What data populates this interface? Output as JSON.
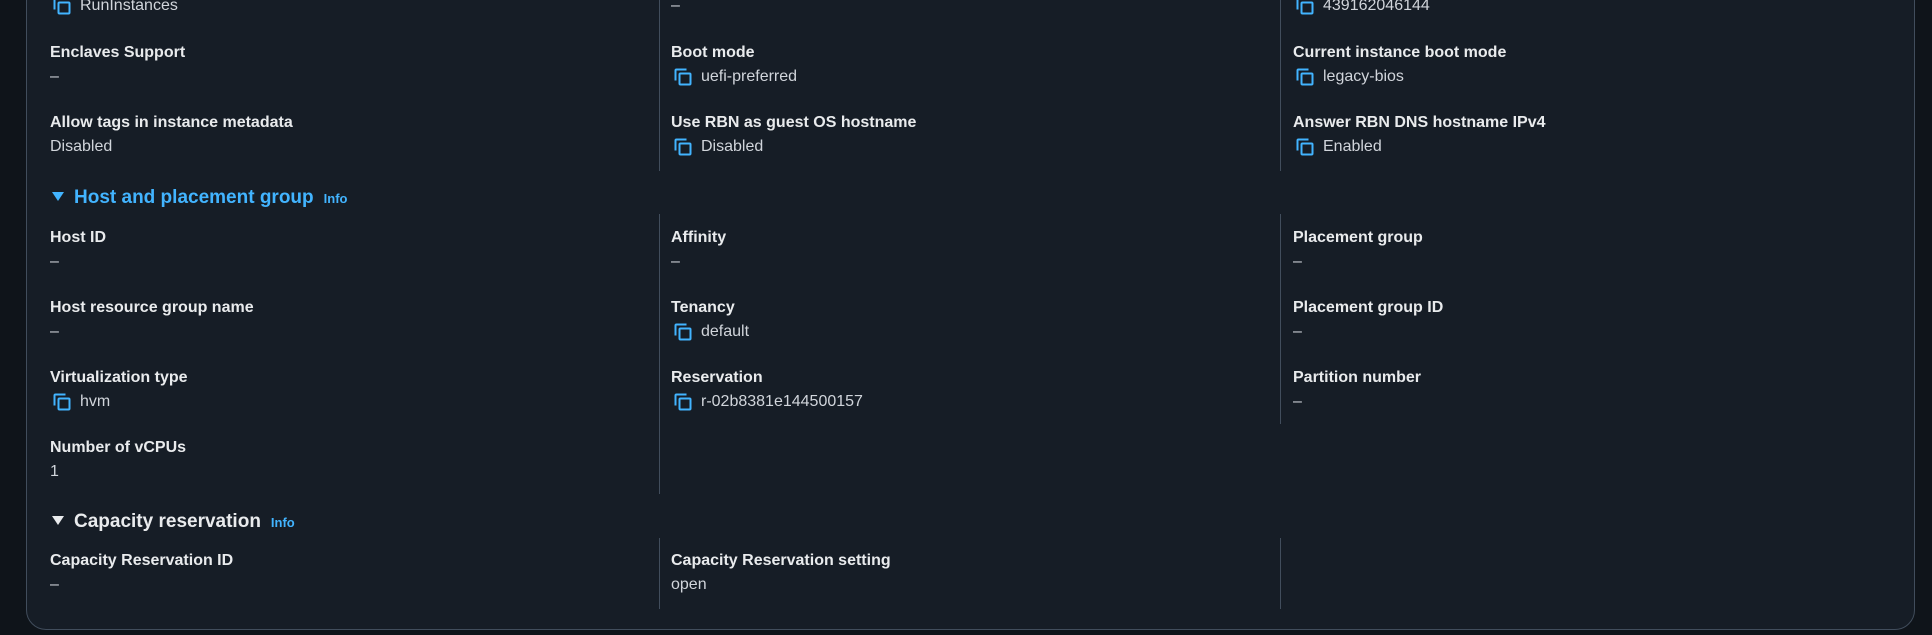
{
  "top": {
    "col1_value": "RunInstances",
    "col2_value": "–",
    "col3_value": "439162046144"
  },
  "instance_details": {
    "enclaves_support": {
      "label": "Enclaves Support",
      "value": "–"
    },
    "boot_mode": {
      "label": "Boot mode",
      "value": "uefi-preferred"
    },
    "current_boot_mode": {
      "label": "Current instance boot mode",
      "value": "legacy-bios"
    },
    "allow_tags": {
      "label": "Allow tags in instance metadata",
      "value": "Disabled"
    },
    "use_rbn": {
      "label": "Use RBN as guest OS hostname",
      "value": "Disabled"
    },
    "answer_rbn": {
      "label": "Answer RBN DNS hostname IPv4",
      "value": "Enabled"
    }
  },
  "host_section": {
    "title": "Host and placement group",
    "info": "Info",
    "host_id": {
      "label": "Host ID",
      "value": "–"
    },
    "affinity": {
      "label": "Affinity",
      "value": "–"
    },
    "placement_group": {
      "label": "Placement group",
      "value": "–"
    },
    "host_resource_group": {
      "label": "Host resource group name",
      "value": "–"
    },
    "tenancy": {
      "label": "Tenancy",
      "value": "default"
    },
    "placement_group_id": {
      "label": "Placement group ID",
      "value": "–"
    },
    "virtualization_type": {
      "label": "Virtualization type",
      "value": "hvm"
    },
    "reservation": {
      "label": "Reservation",
      "value": "r-02b8381e144500157"
    },
    "partition_number": {
      "label": "Partition number",
      "value": "–"
    },
    "vcpus": {
      "label": "Number of vCPUs",
      "value": "1"
    }
  },
  "capacity_section": {
    "title": "Capacity reservation",
    "info": "Info",
    "reservation_id": {
      "label": "Capacity Reservation ID",
      "value": "–"
    },
    "reservation_setting": {
      "label": "Capacity Reservation setting",
      "value": "open"
    }
  },
  "colors": {
    "link": "#42b4ff",
    "background": "#0f141a",
    "panel": "#161d26",
    "divider": "#414d5c"
  }
}
